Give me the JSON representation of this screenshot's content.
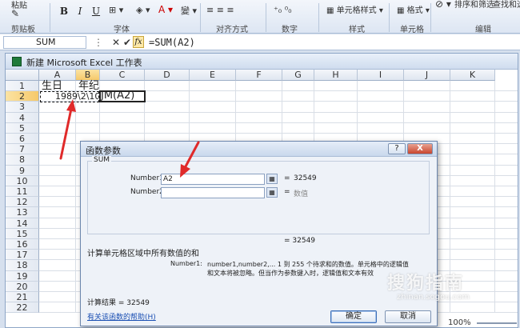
{
  "ribbon": {
    "paste": "粘贴",
    "groups": {
      "clipboard": "剪贴板",
      "font": "字体",
      "alignment": "对齐方式",
      "number": "数字",
      "styles": "样式",
      "cells": "单元格",
      "editing": "编辑"
    },
    "cell_styles": "单元格样式",
    "format": "格式",
    "sort_filter": "排序和筛选",
    "find_select": "查找和选择",
    "bold": "B",
    "italic": "I",
    "underline": "U"
  },
  "formula_bar": {
    "name_box": "SUM",
    "cancel": "✕",
    "enter": "✔",
    "fx": "fx",
    "formula": "=SUM(A2)"
  },
  "workbook": {
    "title": "新建 Microsoft Excel 工作表",
    "columns": [
      "A",
      "B",
      "C",
      "D",
      "E",
      "F",
      "G",
      "H",
      "I",
      "J",
      "K"
    ],
    "rows": [
      "1",
      "2",
      "3",
      "4",
      "5",
      "6",
      "7",
      "8",
      "9",
      "10",
      "11",
      "12",
      "13",
      "14",
      "15",
      "16",
      "17",
      "18",
      "19",
      "20",
      "21",
      "22"
    ],
    "cells": {
      "A1": "生日",
      "B1": "年纪",
      "A2": "1989\\2\\10",
      "B2": "JM(A2)"
    }
  },
  "dialog": {
    "title": "函数参数",
    "help_btn": "?",
    "close_btn": "X",
    "function_name": "SUM",
    "args": [
      {
        "label": "Number1",
        "value": "A2",
        "result": "32549"
      },
      {
        "label": "Number2",
        "value": "",
        "result": "数值"
      }
    ],
    "eq": "=",
    "total_eq": "= 32549",
    "description": "计算单元格区域中所有数值的和",
    "arg_help_label": "Number1:",
    "arg_help_line1": "number1,number2,... 1 到 255 个待求和的数值。单元格中的逻辑值",
    "arg_help_line2": "和文本将被忽略。但当作为参数键入时，逻辑值和文本有效",
    "result_label": "计算结果 = 32549",
    "help_link": "有关该函数的帮助(H)",
    "ok": "确定",
    "cancel": "取消"
  },
  "watermark": {
    "main": "搜狗指南",
    "url": "zhinan.sogou.com"
  },
  "status": {
    "zoom": "100%"
  },
  "colors": {
    "arrow": "#e02a2a",
    "ribbon_bg": "#dde6f3",
    "header_selected": "#f6c96a"
  }
}
